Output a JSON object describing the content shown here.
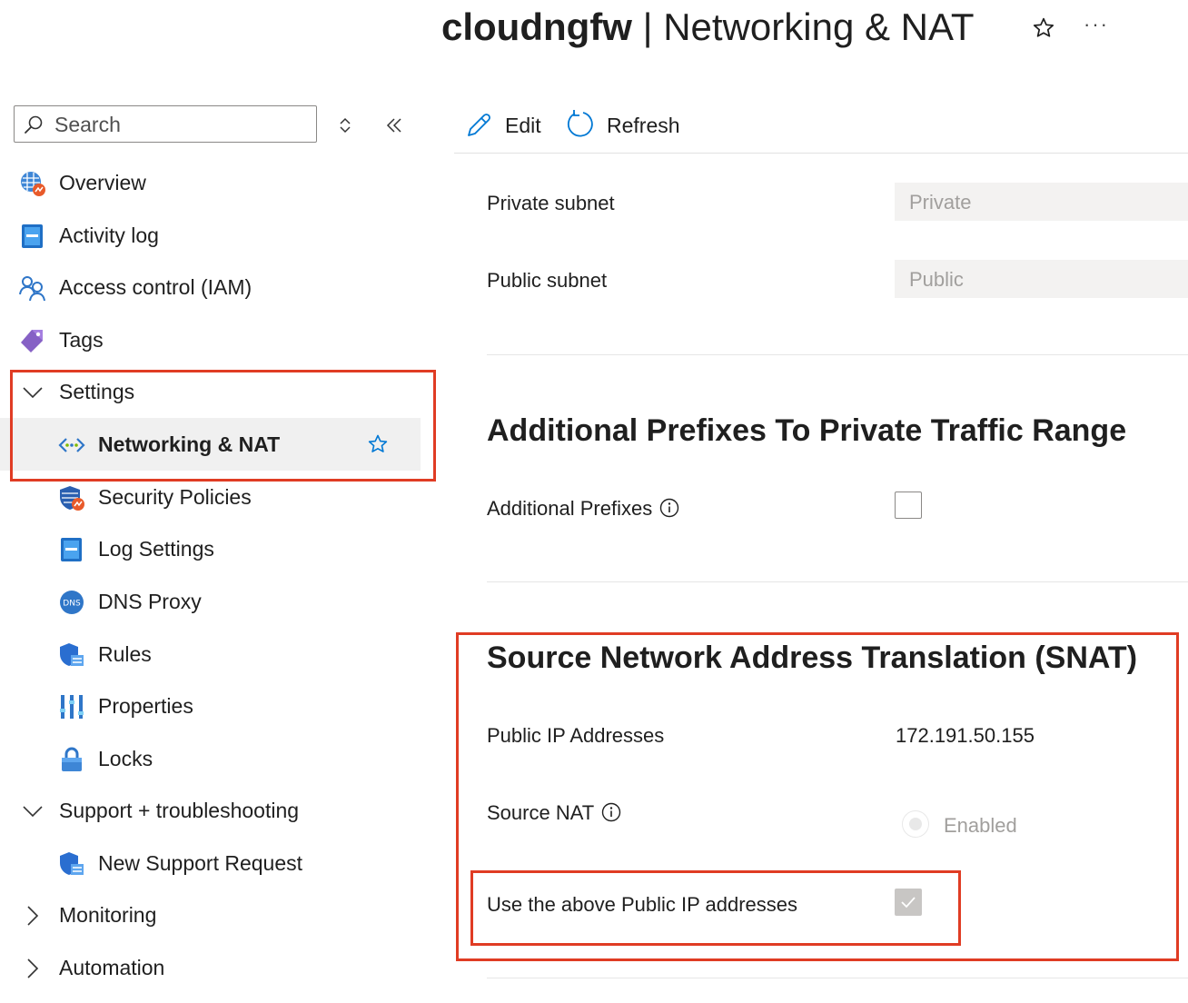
{
  "header": {
    "resource_name": "cloudngfw",
    "separator": " | ",
    "page_name": "Networking & NAT",
    "more_label": "···"
  },
  "sidebar": {
    "search_placeholder": "Search",
    "items": [
      {
        "label": "Overview",
        "icon": "firewall-overview-icon"
      },
      {
        "label": "Activity log",
        "icon": "activity-log-icon"
      },
      {
        "label": "Access control (IAM)",
        "icon": "iam-people-icon"
      },
      {
        "label": "Tags",
        "icon": "tag-icon"
      },
      {
        "label": "Settings",
        "icon": "chevron-down-icon"
      },
      {
        "label": "Networking & NAT",
        "icon": "networking-icon",
        "selected": true
      },
      {
        "label": "Security Policies",
        "icon": "security-shield-icon"
      },
      {
        "label": "Log Settings",
        "icon": "log-settings-icon"
      },
      {
        "label": "DNS Proxy",
        "icon": "dns-icon"
      },
      {
        "label": "Rules",
        "icon": "rules-shield-icon"
      },
      {
        "label": "Properties",
        "icon": "properties-bars-icon"
      },
      {
        "label": "Locks",
        "icon": "lock-icon"
      },
      {
        "label": "Support + troubleshooting",
        "icon": "chevron-down-icon"
      },
      {
        "label": "New Support Request",
        "icon": "support-request-icon"
      },
      {
        "label": "Monitoring",
        "icon": "chevron-right-icon"
      },
      {
        "label": "Automation",
        "icon": "chevron-right-icon"
      }
    ],
    "dns_icon_text": "DNS"
  },
  "toolbar": {
    "edit_label": "Edit",
    "refresh_label": "Refresh"
  },
  "subnets": {
    "private_label": "Private subnet",
    "private_value": "Private",
    "public_label": "Public subnet",
    "public_value": "Public"
  },
  "prefixes": {
    "title": "Additional Prefixes To Private Traffic Range",
    "label": "Additional Prefixes",
    "checked": false
  },
  "snat": {
    "title": "Source Network Address Translation (SNAT)",
    "public_ip_label": "Public IP Addresses",
    "public_ip_value": "172.191.50.155",
    "source_nat_label": "Source NAT",
    "source_nat_option": "Enabled",
    "use_above_label": "Use the above Public IP addresses",
    "use_above_checked": true
  },
  "colors": {
    "highlight_border": "#e03c24",
    "accent": "#0078d4",
    "selected_bg": "#f0f0f0"
  }
}
